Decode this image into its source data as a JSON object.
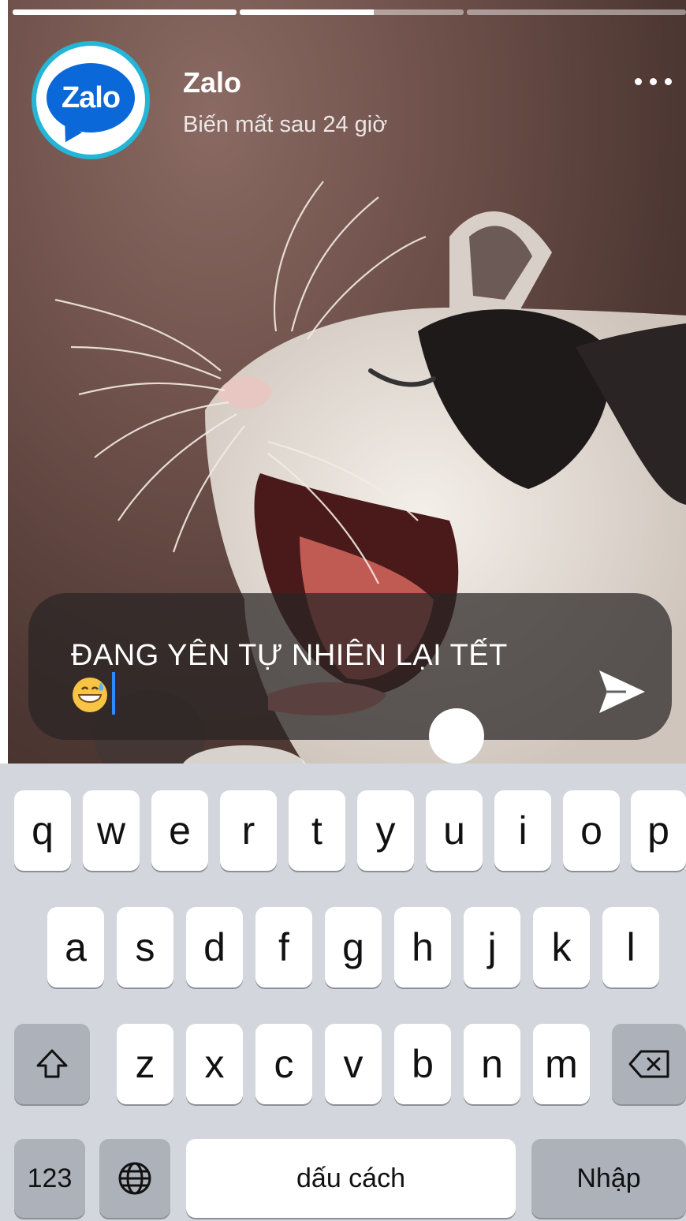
{
  "story": {
    "account_name": "Zalo",
    "expiry": "Biến mất sau 24 giờ",
    "avatar_logo": "Zalo",
    "progress": [
      1.0,
      0.6,
      0.0
    ],
    "more_icon": "more-dots-icon"
  },
  "reply": {
    "text": "ĐANG YÊN TỰ NHIÊN LẠI TẾT",
    "emoji": "grinning-sweat-face-icon",
    "send_icon": "send-icon"
  },
  "keyboard": {
    "row1": [
      "q",
      "w",
      "e",
      "r",
      "t",
      "y",
      "u",
      "i",
      "o",
      "p"
    ],
    "row2": [
      "a",
      "s",
      "d",
      "f",
      "g",
      "h",
      "j",
      "k",
      "l"
    ],
    "row3": [
      "z",
      "x",
      "c",
      "v",
      "b",
      "n",
      "m"
    ],
    "numbers_label": "123",
    "space_label": "dấu cách",
    "return_label": "Nhập",
    "shift_icon": "shift-icon",
    "delete_icon": "backspace-icon",
    "globe_icon": "globe-icon"
  },
  "colors": {
    "zalo_blue": "#0a68d8",
    "avatar_ring": "#23b6d6",
    "cursor": "#2b8cff"
  }
}
